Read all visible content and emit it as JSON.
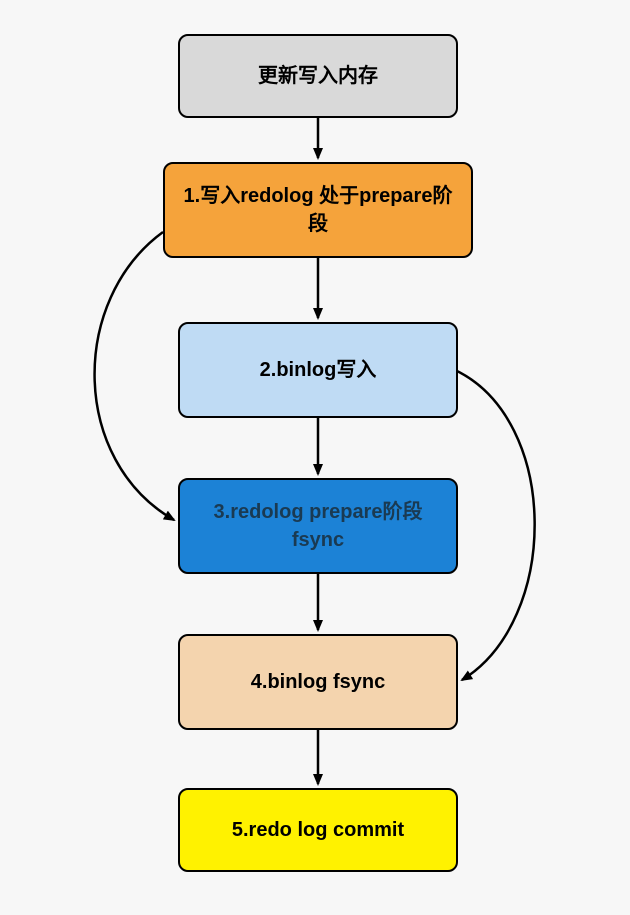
{
  "chart_data": {
    "type": "flowchart",
    "nodes": [
      {
        "id": "n0",
        "label": "更新写入内存",
        "fill": "gray"
      },
      {
        "id": "n1",
        "label": "1.写入redolog 处于prepare阶段",
        "fill": "orange"
      },
      {
        "id": "n2",
        "label": "2.binlog写入",
        "fill": "lightblue"
      },
      {
        "id": "n3",
        "label": "3.redolog prepare阶段fsync",
        "fill": "blue"
      },
      {
        "id": "n4",
        "label": "4.binlog fsync",
        "fill": "tan"
      },
      {
        "id": "n5",
        "label": "5.redo log commit",
        "fill": "yellow"
      }
    ],
    "edges": [
      {
        "from": "n0",
        "to": "n1"
      },
      {
        "from": "n1",
        "to": "n2"
      },
      {
        "from": "n2",
        "to": "n3"
      },
      {
        "from": "n3",
        "to": "n4"
      },
      {
        "from": "n4",
        "to": "n5"
      },
      {
        "from": "n1",
        "to": "n3",
        "style": "curved-left"
      },
      {
        "from": "n2",
        "to": "n4",
        "style": "curved-right"
      }
    ]
  },
  "nodes": {
    "n0": "更新写入内存",
    "n1": "1.写入redolog 处于prepare阶段",
    "n2": "2.binlog写入",
    "n3": "3.redolog prepare阶段fsync",
    "n4": "4.binlog fsync",
    "n5": "5.redo log commit"
  }
}
